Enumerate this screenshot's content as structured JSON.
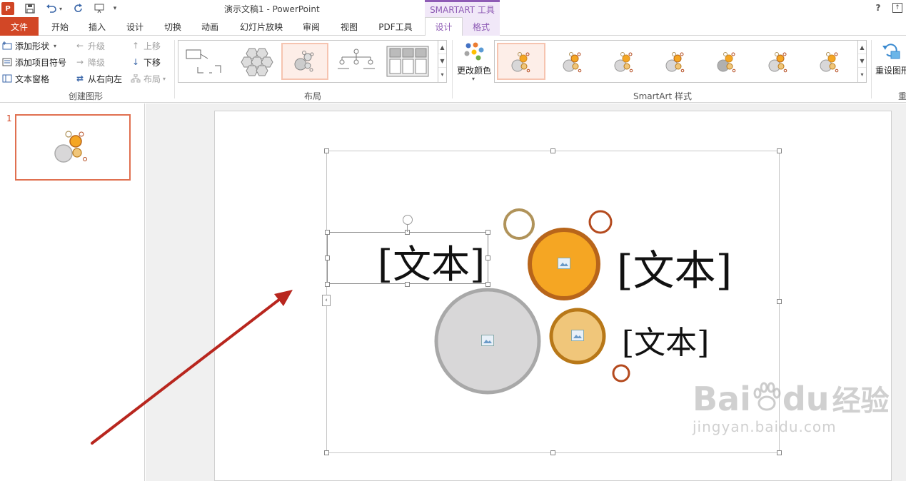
{
  "window": {
    "title": "演示文稿1 - PowerPoint",
    "context_tools_label": "SMARTART 工具",
    "app_icon_text": "P",
    "help": "?"
  },
  "tabs": [
    {
      "label": "文件"
    },
    {
      "label": "开始"
    },
    {
      "label": "插入"
    },
    {
      "label": "设计"
    },
    {
      "label": "切换"
    },
    {
      "label": "动画"
    },
    {
      "label": "幻灯片放映"
    },
    {
      "label": "审阅"
    },
    {
      "label": "视图"
    },
    {
      "label": "PDF工具"
    },
    {
      "label": "设计"
    },
    {
      "label": "格式"
    }
  ],
  "ribbon": {
    "create_graphic": {
      "label": "创建图形",
      "add_shape": "添加形状",
      "add_bullet": "添加项目符号",
      "text_pane": "文本窗格",
      "promote": "升级",
      "demote": "降级",
      "right_to_left": "从右向左",
      "move_up": "上移",
      "move_down": "下移",
      "layout": "布局"
    },
    "layouts": {
      "label": "布局"
    },
    "change_colors": "更改颜色",
    "smartart_styles": {
      "label": "SmartArt 样式"
    },
    "reset_graphic": "重设图形",
    "reset_group_partial": "重"
  },
  "thumbnails": [
    {
      "number": "1"
    }
  ],
  "slide": {
    "text_items": [
      "[文本]",
      "[文本]",
      "[文本]"
    ]
  },
  "colors": {
    "file_tab": "#d24726",
    "context_purple": "#8e5bb5",
    "bubble_orange": "#f5a623",
    "bubble_orange_ring": "#b8651a",
    "bubble_tan": "#f0c67a",
    "bubble_tan_ring": "#b87818",
    "bubble_gray": "#d8d7d8",
    "bubble_gray_ring": "#a8a8a8",
    "small_ring_red": "#b44a1e",
    "small_ring_olive": "#b0935a",
    "arrow_red": "#b8261e"
  },
  "watermark": {
    "brand": "Bai",
    "brand2": "du",
    "cn": "经验",
    "url": "jingyan.baidu.com"
  }
}
